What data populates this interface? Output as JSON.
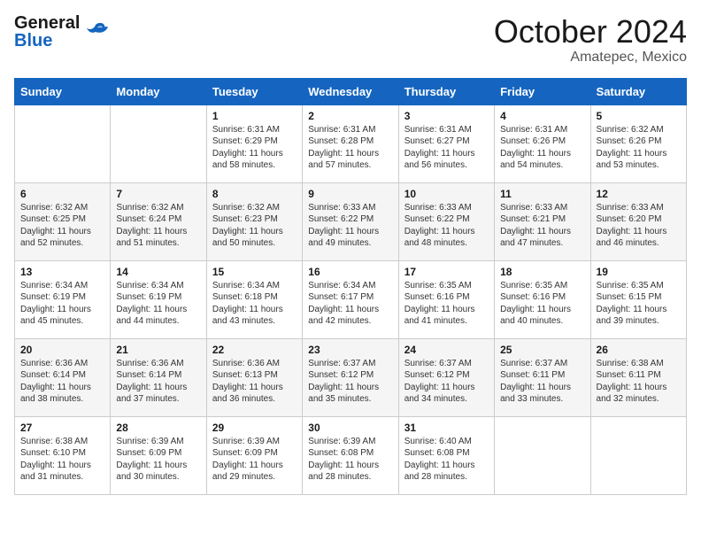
{
  "header": {
    "logo_general": "General",
    "logo_blue": "Blue",
    "month": "October 2024",
    "location": "Amatepec, Mexico"
  },
  "days_of_week": [
    "Sunday",
    "Monday",
    "Tuesday",
    "Wednesday",
    "Thursday",
    "Friday",
    "Saturday"
  ],
  "weeks": [
    [
      {
        "day": "",
        "info": ""
      },
      {
        "day": "",
        "info": ""
      },
      {
        "day": "1",
        "info": "Sunrise: 6:31 AM\nSunset: 6:29 PM\nDaylight: 11 hours and 58 minutes."
      },
      {
        "day": "2",
        "info": "Sunrise: 6:31 AM\nSunset: 6:28 PM\nDaylight: 11 hours and 57 minutes."
      },
      {
        "day": "3",
        "info": "Sunrise: 6:31 AM\nSunset: 6:27 PM\nDaylight: 11 hours and 56 minutes."
      },
      {
        "day": "4",
        "info": "Sunrise: 6:31 AM\nSunset: 6:26 PM\nDaylight: 11 hours and 54 minutes."
      },
      {
        "day": "5",
        "info": "Sunrise: 6:32 AM\nSunset: 6:26 PM\nDaylight: 11 hours and 53 minutes."
      }
    ],
    [
      {
        "day": "6",
        "info": "Sunrise: 6:32 AM\nSunset: 6:25 PM\nDaylight: 11 hours and 52 minutes."
      },
      {
        "day": "7",
        "info": "Sunrise: 6:32 AM\nSunset: 6:24 PM\nDaylight: 11 hours and 51 minutes."
      },
      {
        "day": "8",
        "info": "Sunrise: 6:32 AM\nSunset: 6:23 PM\nDaylight: 11 hours and 50 minutes."
      },
      {
        "day": "9",
        "info": "Sunrise: 6:33 AM\nSunset: 6:22 PM\nDaylight: 11 hours and 49 minutes."
      },
      {
        "day": "10",
        "info": "Sunrise: 6:33 AM\nSunset: 6:22 PM\nDaylight: 11 hours and 48 minutes."
      },
      {
        "day": "11",
        "info": "Sunrise: 6:33 AM\nSunset: 6:21 PM\nDaylight: 11 hours and 47 minutes."
      },
      {
        "day": "12",
        "info": "Sunrise: 6:33 AM\nSunset: 6:20 PM\nDaylight: 11 hours and 46 minutes."
      }
    ],
    [
      {
        "day": "13",
        "info": "Sunrise: 6:34 AM\nSunset: 6:19 PM\nDaylight: 11 hours and 45 minutes."
      },
      {
        "day": "14",
        "info": "Sunrise: 6:34 AM\nSunset: 6:19 PM\nDaylight: 11 hours and 44 minutes."
      },
      {
        "day": "15",
        "info": "Sunrise: 6:34 AM\nSunset: 6:18 PM\nDaylight: 11 hours and 43 minutes."
      },
      {
        "day": "16",
        "info": "Sunrise: 6:34 AM\nSunset: 6:17 PM\nDaylight: 11 hours and 42 minutes."
      },
      {
        "day": "17",
        "info": "Sunrise: 6:35 AM\nSunset: 6:16 PM\nDaylight: 11 hours and 41 minutes."
      },
      {
        "day": "18",
        "info": "Sunrise: 6:35 AM\nSunset: 6:16 PM\nDaylight: 11 hours and 40 minutes."
      },
      {
        "day": "19",
        "info": "Sunrise: 6:35 AM\nSunset: 6:15 PM\nDaylight: 11 hours and 39 minutes."
      }
    ],
    [
      {
        "day": "20",
        "info": "Sunrise: 6:36 AM\nSunset: 6:14 PM\nDaylight: 11 hours and 38 minutes."
      },
      {
        "day": "21",
        "info": "Sunrise: 6:36 AM\nSunset: 6:14 PM\nDaylight: 11 hours and 37 minutes."
      },
      {
        "day": "22",
        "info": "Sunrise: 6:36 AM\nSunset: 6:13 PM\nDaylight: 11 hours and 36 minutes."
      },
      {
        "day": "23",
        "info": "Sunrise: 6:37 AM\nSunset: 6:12 PM\nDaylight: 11 hours and 35 minutes."
      },
      {
        "day": "24",
        "info": "Sunrise: 6:37 AM\nSunset: 6:12 PM\nDaylight: 11 hours and 34 minutes."
      },
      {
        "day": "25",
        "info": "Sunrise: 6:37 AM\nSunset: 6:11 PM\nDaylight: 11 hours and 33 minutes."
      },
      {
        "day": "26",
        "info": "Sunrise: 6:38 AM\nSunset: 6:11 PM\nDaylight: 11 hours and 32 minutes."
      }
    ],
    [
      {
        "day": "27",
        "info": "Sunrise: 6:38 AM\nSunset: 6:10 PM\nDaylight: 11 hours and 31 minutes."
      },
      {
        "day": "28",
        "info": "Sunrise: 6:39 AM\nSunset: 6:09 PM\nDaylight: 11 hours and 30 minutes."
      },
      {
        "day": "29",
        "info": "Sunrise: 6:39 AM\nSunset: 6:09 PM\nDaylight: 11 hours and 29 minutes."
      },
      {
        "day": "30",
        "info": "Sunrise: 6:39 AM\nSunset: 6:08 PM\nDaylight: 11 hours and 28 minutes."
      },
      {
        "day": "31",
        "info": "Sunrise: 6:40 AM\nSunset: 6:08 PM\nDaylight: 11 hours and 28 minutes."
      },
      {
        "day": "",
        "info": ""
      },
      {
        "day": "",
        "info": ""
      }
    ]
  ]
}
